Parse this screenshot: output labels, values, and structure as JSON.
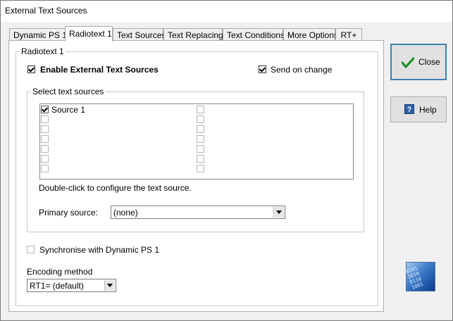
{
  "window": {
    "title": "External Text Sources"
  },
  "tabs": [
    {
      "label": "Dynamic PS 1"
    },
    {
      "label": "Radiotext 1"
    },
    {
      "label": "Text Sources"
    },
    {
      "label": "Text Replacing"
    },
    {
      "label": "Text Conditions"
    },
    {
      "label": "More Options"
    },
    {
      "label": "RT+"
    }
  ],
  "active_tab": "Radiotext 1",
  "radiotext_group": {
    "label": "Radiotext 1"
  },
  "enable_external": {
    "label": "Enable External Text Sources",
    "checked": true
  },
  "send_on_change": {
    "label": "Send on change",
    "checked": true
  },
  "select_sources_group": {
    "label": "Select text sources"
  },
  "sources": [
    {
      "label": "Source 1",
      "checked": true
    },
    {
      "label": "",
      "checked": false
    },
    {
      "label": "",
      "checked": false
    },
    {
      "label": "",
      "checked": false
    },
    {
      "label": "",
      "checked": false
    },
    {
      "label": "",
      "checked": false
    },
    {
      "label": "",
      "checked": false
    },
    {
      "label": "",
      "checked": false
    },
    {
      "label": "",
      "checked": false
    },
    {
      "label": "",
      "checked": false
    },
    {
      "label": "",
      "checked": false
    },
    {
      "label": "",
      "checked": false
    },
    {
      "label": "",
      "checked": false
    },
    {
      "label": "",
      "checked": false
    }
  ],
  "hint": "Double-click to configure the text source.",
  "primary_source": {
    "label": "Primary source:",
    "value": "(none)"
  },
  "synchronise": {
    "label": "Synchronise with Dynamic PS 1",
    "checked": false
  },
  "encoding": {
    "label": "Encoding method",
    "value": "RT1= (default)"
  },
  "buttons": {
    "close": "Close",
    "help": "Help"
  },
  "decor": {
    "bits": "0101\n1010\n0110\n1001"
  }
}
